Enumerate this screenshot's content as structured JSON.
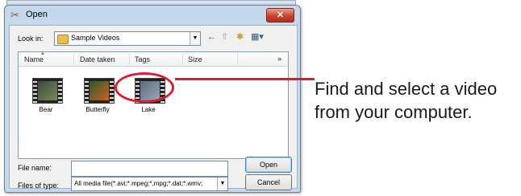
{
  "dialog": {
    "title": "Open",
    "close_label": "✕"
  },
  "lookin": {
    "label": "Look in:",
    "value": "Sample Videos"
  },
  "columns": [
    "Name",
    "Date taken",
    "Tags",
    "Size"
  ],
  "more_columns": "»",
  "files": [
    {
      "name": "Bear",
      "colors": [
        "#3a4a3a",
        "#7a8a5a"
      ]
    },
    {
      "name": "Butterfly",
      "colors": [
        "#2a5a2a",
        "#d06020"
      ]
    },
    {
      "name": "Lake",
      "colors": [
        "#5a6a7a",
        "#9aaabb"
      ]
    }
  ],
  "filename": {
    "label": "File name:",
    "value": ""
  },
  "filetype": {
    "label": "Files of type:",
    "value": "All media file(*.avi;*.mpeg;*.mpg;*.dat;*.wmv;"
  },
  "buttons": {
    "open": "Open",
    "cancel": "Cancel"
  },
  "callout": {
    "line1": "Find and select a video",
    "line2": "from your computer.",
    "color": "#e01b2e"
  }
}
